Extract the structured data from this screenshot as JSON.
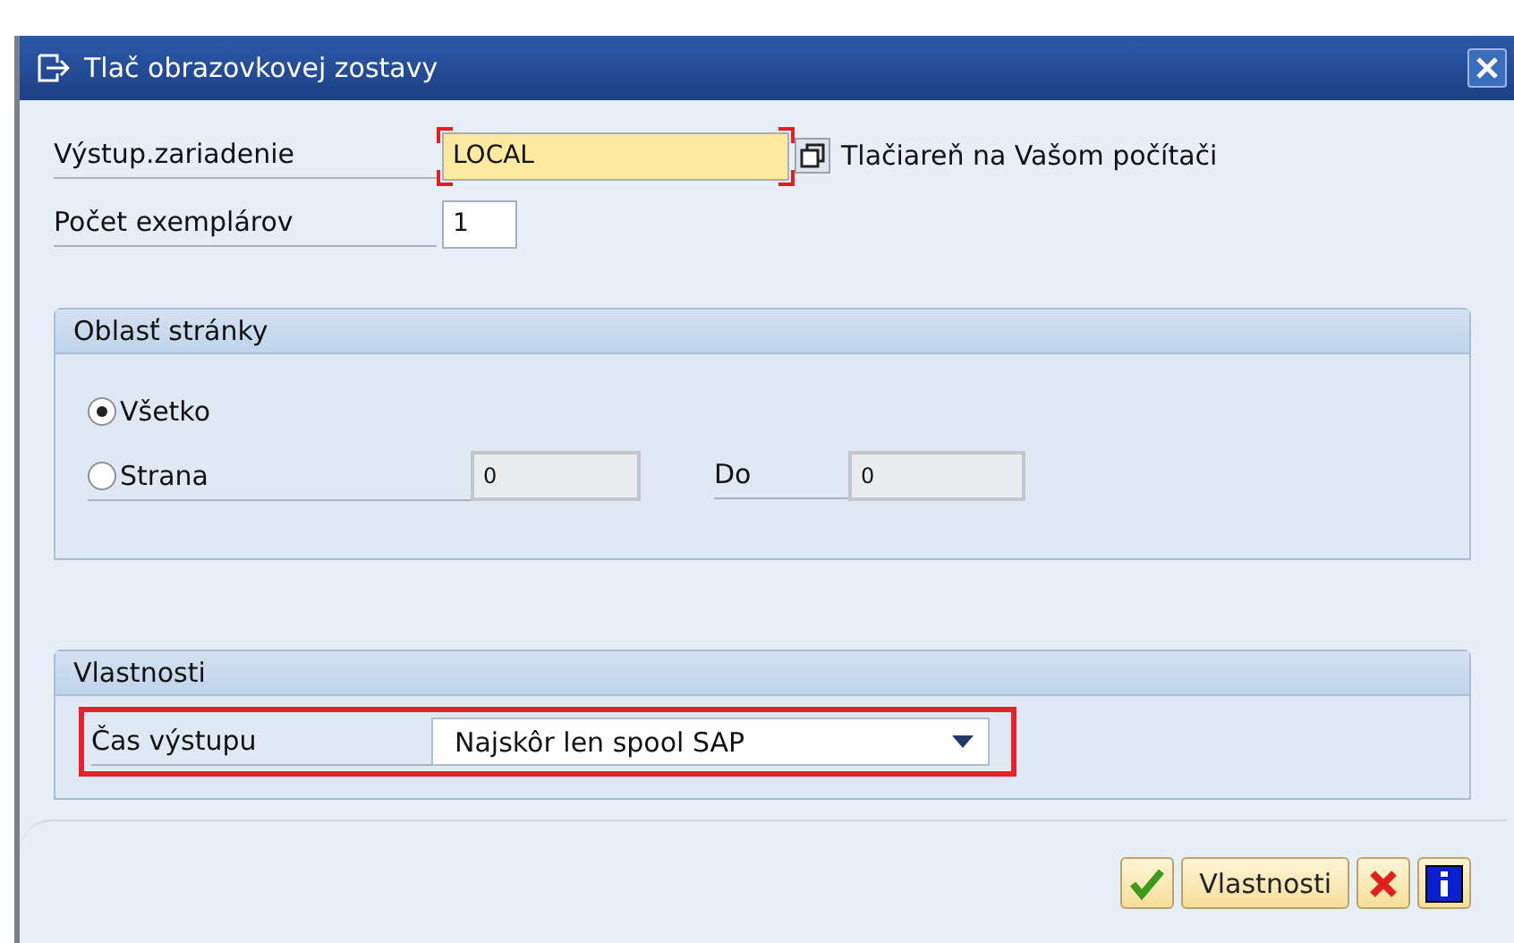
{
  "window": {
    "title": "Tlač obrazovkovej zostavy"
  },
  "output_device": {
    "label": "Výstup.zariadenie",
    "value": "LOCAL",
    "description": "Tlačiareň na Vašom počítači"
  },
  "copies": {
    "label": "Počet exemplárov",
    "value": "1"
  },
  "page_area": {
    "title": "Oblasť stránky",
    "options": [
      {
        "label": "Všetko",
        "selected": true
      },
      {
        "label": "Strana",
        "selected": false
      }
    ],
    "from_value": "0",
    "to_label": "Do",
    "to_value": "0"
  },
  "properties": {
    "title": "Vlastnosti",
    "output_time_label": "Čas výstupu",
    "output_time_value": "Najskôr len spool SAP"
  },
  "buttons": [
    {
      "kind": "confirm"
    },
    {
      "kind": "text",
      "label": "Vlastnosti"
    },
    {
      "kind": "cancel"
    },
    {
      "kind": "info"
    }
  ]
}
